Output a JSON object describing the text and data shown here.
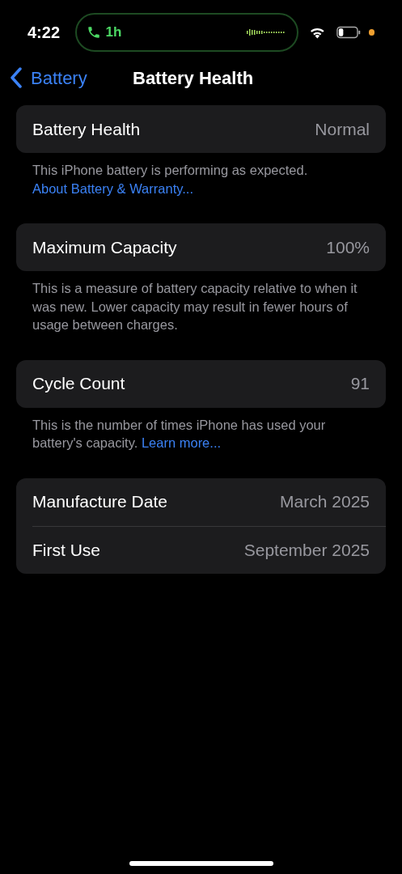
{
  "status_bar": {
    "time": "4:22",
    "call_duration": "1h"
  },
  "nav": {
    "back": "Battery",
    "title": "Battery Health"
  },
  "groups": [
    {
      "rows": [
        {
          "label": "Battery Health",
          "value": "Normal"
        }
      ],
      "footer": {
        "text": "This iPhone battery is performing as expected.",
        "link": "About Battery & Warranty...",
        "kind": "link_below"
      }
    },
    {
      "rows": [
        {
          "label": "Maximum Capacity",
          "value": "100%"
        }
      ],
      "footer": {
        "text": "This is a measure of battery capacity relative to when it was new. Lower capacity may result in fewer hours of usage between charges."
      }
    },
    {
      "rows": [
        {
          "label": "Cycle Count",
          "value": "91"
        }
      ],
      "footer": {
        "text": "This is the number of times iPhone has used your battery's capacity.",
        "link": "Learn more...",
        "kind": "link_inline"
      }
    },
    {
      "rows": [
        {
          "label": "Manufacture Date",
          "value": "March 2025"
        },
        {
          "label": "First Use",
          "value": "September 2025"
        }
      ]
    }
  ]
}
